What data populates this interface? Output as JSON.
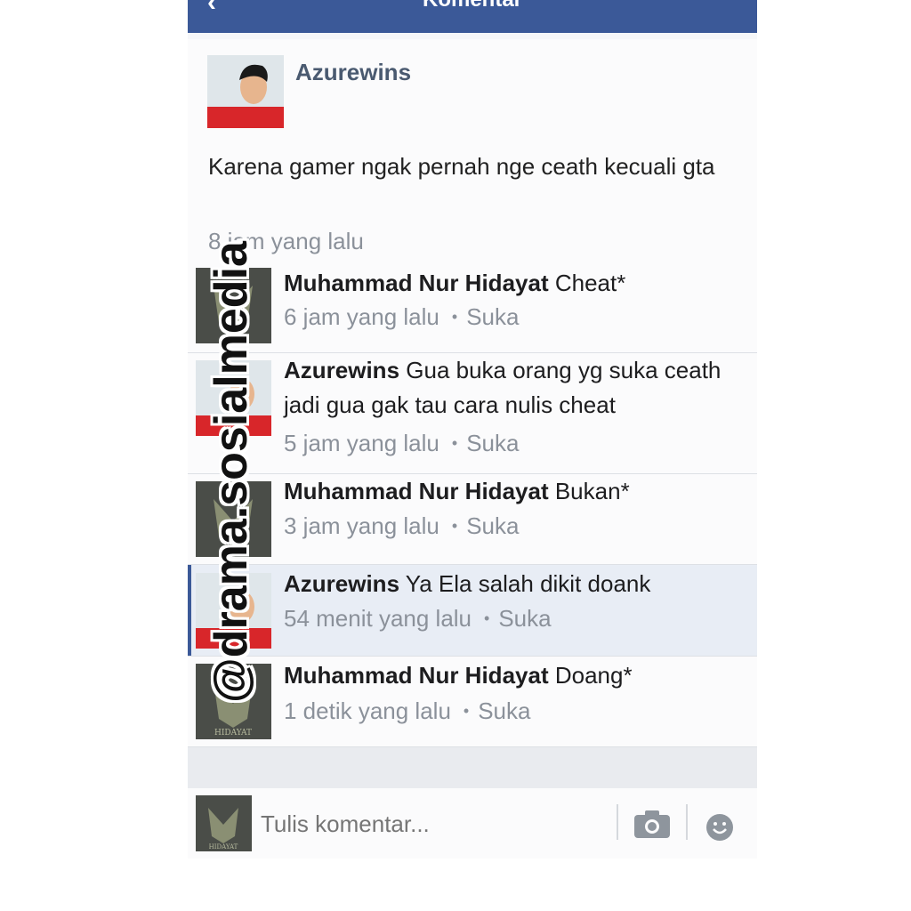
{
  "topbar": {
    "title": "Komentar",
    "back_icon": "back-arrow-icon"
  },
  "post": {
    "author": "Azurewins",
    "text": "Karena gamer ngak pernah nge ceath kecuali gta",
    "time": "8 jam yang lalu"
  },
  "replies": [
    {
      "name": "Muhammad Nur Hidayat",
      "text": "Cheat*",
      "time": "6 jam yang lalu",
      "like": "Suka"
    },
    {
      "name": "Azurewins",
      "text": "Gua buka orang yg suka ceath jadi gua gak tau cara nulis cheat",
      "time": "5 jam yang lalu",
      "like": "Suka"
    },
    {
      "name": "Muhammad Nur Hidayat",
      "text": "Bukan*",
      "time": "3 jam yang lalu",
      "like": "Suka"
    },
    {
      "name": "Azurewins",
      "text": "Ya Ela salah dikit doank",
      "time": "54 menit yang lalu",
      "like": "Suka"
    },
    {
      "name": "Muhammad Nur Hidayat",
      "text": "Doang*",
      "time": "1 detik yang lalu",
      "like": "Suka"
    }
  ],
  "composer": {
    "placeholder": "Tulis komentar...",
    "camera_icon": "camera-icon",
    "emoji_icon": "emoji-icon"
  },
  "watermark": "@drama.sosialmedia",
  "avatar_labels": {
    "hidayat": "HIDAYAT"
  },
  "colors": {
    "brand": "#3b5998",
    "meta": "#8b919a",
    "name": "#4a5a70"
  }
}
